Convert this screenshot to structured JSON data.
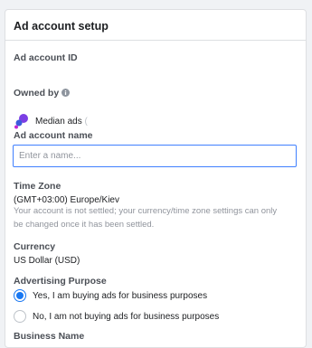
{
  "header": {
    "title": "Ad account setup"
  },
  "ad_account_id": {
    "label": "Ad account ID",
    "value": ""
  },
  "owned_by": {
    "label": "Owned by",
    "owner_name": "Median ads",
    "owner_suffix": "(",
    "info_icon": "info-circle-icon",
    "avatar_icon": "business-logo-icon"
  },
  "ad_account_name": {
    "label": "Ad account name",
    "value": "",
    "placeholder": "Enter a name..."
  },
  "time_zone": {
    "label": "Time Zone",
    "value": "(GMT+03:00) Europe/Kiev",
    "help": "Your account is not settled; your currency/time zone settings can only be changed once it has been settled."
  },
  "currency": {
    "label": "Currency",
    "value": "US Dollar (USD)"
  },
  "advertising_purpose": {
    "label": "Advertising Purpose",
    "options": [
      {
        "label": "Yes, I am buying ads for business purposes",
        "selected": true
      },
      {
        "label": "No, I am not buying ads for business purposes",
        "selected": false
      }
    ]
  },
  "business_name": {
    "label": "Business Name"
  },
  "colors": {
    "accent": "#1877f2",
    "input_border": "#4080ff",
    "text": "#1c1e21",
    "muted": "#90949c"
  }
}
